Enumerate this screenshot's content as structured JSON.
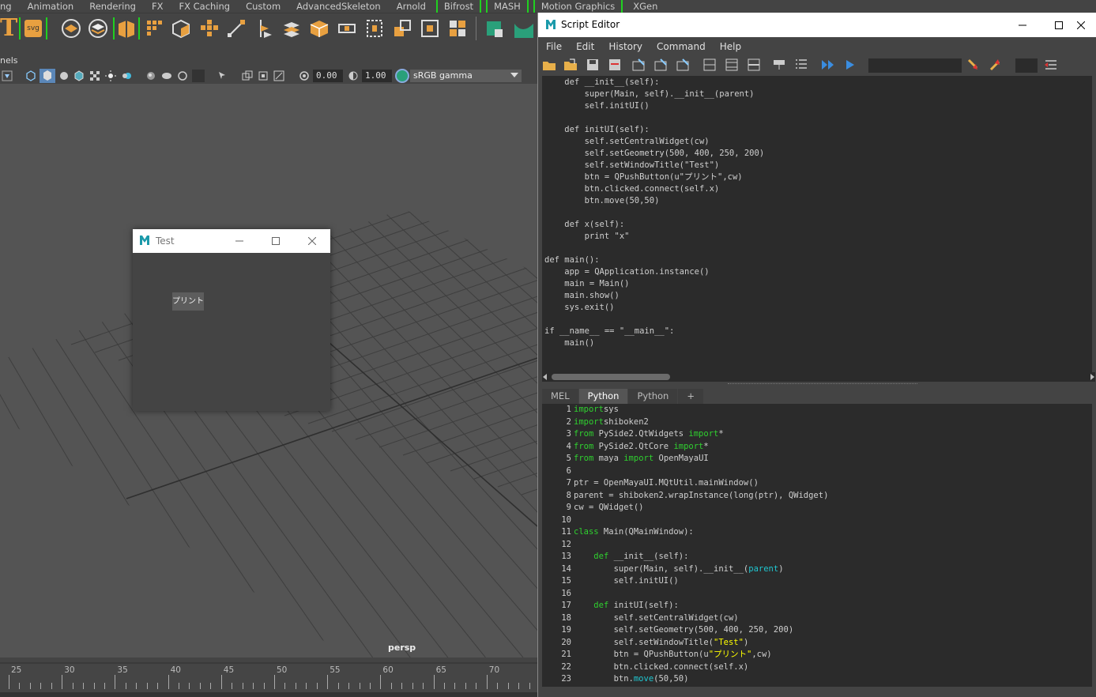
{
  "shelf_tabs": [
    "ng",
    "Animation",
    "Rendering",
    "FX",
    "FX Caching",
    "Custom",
    "AdvancedSkeleton",
    "Arnold",
    "Bifrost",
    "MASH",
    "Motion Graphics",
    "XGen"
  ],
  "shelf": {
    "svg_label": "svg"
  },
  "panel_label": "nels",
  "viewport_toolbar": {
    "value_a": "0.00",
    "value_b": "1.00",
    "gamma": "sRGB gamma"
  },
  "viewport": {
    "camera_label": "persp"
  },
  "timeline": {
    "ticks": [
      "25",
      "30",
      "35",
      "40",
      "45",
      "50",
      "55",
      "60",
      "65",
      "70"
    ]
  },
  "test_window": {
    "title": "Test",
    "button_label": "プリント"
  },
  "script_editor": {
    "title": "Script Editor",
    "menu": [
      "File",
      "Edit",
      "History",
      "Command",
      "Help"
    ],
    "tabs": [
      "MEL",
      "Python",
      "Python",
      "+"
    ],
    "active_tab": 1,
    "history_lines": [
      "    def __init__(self):",
      "        super(Main, self).__init__(parent)",
      "        self.initUI()",
      "",
      "    def initUI(self):",
      "        self.setCentralWidget(cw)",
      "        self.setGeometry(500, 400, 250, 200)",
      "        self.setWindowTitle(\"Test\")",
      "        btn = QPushButton(u\"プリント\",cw)",
      "        btn.clicked.connect(self.x)",
      "        btn.move(50,50)",
      "",
      "    def x(self):",
      "        print \"x\"",
      "",
      "def main():",
      "    app = QApplication.instance()",
      "    main = Main()",
      "    main.show()",
      "    sys.exit()",
      "",
      "if __name__ == \"__main__\":",
      "    main()"
    ],
    "line_numbers": [
      "1",
      "2",
      "3",
      "4",
      "5",
      "6",
      "7",
      "8",
      "9",
      "10",
      "11",
      "12",
      "13",
      "14",
      "15",
      "16",
      "17",
      "18",
      "19",
      "20",
      "21",
      "22",
      "23"
    ],
    "code_lines": [
      [
        [
          "kw",
          "import"
        ],
        [
          "",
          "sys"
        ]
      ],
      [
        [
          "kw",
          "import"
        ],
        [
          "",
          "shiboken2"
        ]
      ],
      [
        [
          "kw",
          "from"
        ],
        [
          "",
          " PySide2.QtWidgets "
        ],
        [
          "kw",
          "import"
        ],
        [
          "",
          "*"
        ]
      ],
      [
        [
          "kw",
          "from"
        ],
        [
          "",
          " PySide2.QtCore "
        ],
        [
          "kw",
          "import"
        ],
        [
          "",
          "*"
        ]
      ],
      [
        [
          "kw",
          "from"
        ],
        [
          "",
          " maya "
        ],
        [
          "kw",
          "import"
        ],
        [
          "",
          " OpenMayaUI"
        ]
      ],
      [],
      [
        [
          "",
          "ptr = OpenMayaUI.MQtUtil.mainWindow()"
        ]
      ],
      [
        [
          "",
          "parent = shiboken2.wrapInstance(long(ptr), QWidget)"
        ]
      ],
      [
        [
          "",
          "cw = QWidget()"
        ]
      ],
      [],
      [
        [
          "kw",
          "class"
        ],
        [
          "",
          " Main(QMainWindow):"
        ]
      ],
      [],
      [
        [
          "",
          "    "
        ],
        [
          "kw",
          "def"
        ],
        [
          "",
          " __init__(self):"
        ]
      ],
      [
        [
          "",
          "        super(Main, self).__init__("
        ],
        [
          "bi",
          "parent"
        ],
        [
          "",
          ")"
        ]
      ],
      [
        [
          "",
          "        self.initUI()"
        ]
      ],
      [],
      [
        [
          "",
          "    "
        ],
        [
          "kw",
          "def"
        ],
        [
          "",
          " initUI(self):"
        ]
      ],
      [
        [
          "",
          "        self.setCentralWidget(cw)"
        ]
      ],
      [
        [
          "",
          "        self.setGeometry(500, 400, 250, 200)"
        ]
      ],
      [
        [
          "",
          "        self.setWindowTitle("
        ],
        [
          "str",
          "\"Test\""
        ],
        [
          "",
          ")"
        ]
      ],
      [
        [
          "",
          "        btn = QPushButton(u"
        ],
        [
          "str",
          "\"プリント\""
        ],
        [
          "",
          ",cw)"
        ]
      ],
      [
        [
          "",
          "        btn.clicked.connect(self.x)"
        ]
      ],
      [
        [
          "",
          "        btn."
        ],
        [
          "bi",
          "move"
        ],
        [
          "",
          "(50,50)"
        ]
      ]
    ]
  }
}
